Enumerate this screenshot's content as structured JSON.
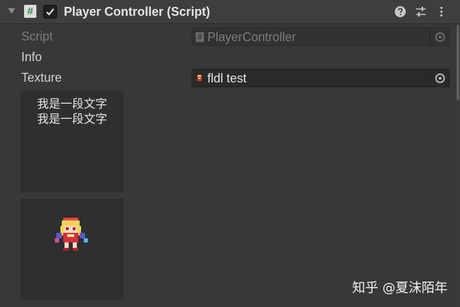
{
  "component": {
    "title": "Player Controller (Script)",
    "enabled": true,
    "icons": [
      "foldout-arrow-icon",
      "csharp-script-icon",
      "help-icon",
      "preset-icon",
      "kebab-menu-icon"
    ]
  },
  "fields": {
    "script": {
      "label": "Script",
      "value": "PlayerController",
      "icon": "#"
    },
    "info": {
      "label": "Info"
    },
    "texture": {
      "label": "Texture",
      "value": "fldl test",
      "icon": "texture-thumbnail-icon"
    }
  },
  "preview": {
    "text_lines": [
      "我是一段文字",
      "我是一段文字"
    ],
    "image": "pixel-character-sprite"
  },
  "watermark": "知乎 @夏沫陌年",
  "colors": {
    "background": "#383838",
    "header": "#3e3e3e",
    "field": "#2a2a2a",
    "text": "#d2d2d2"
  }
}
